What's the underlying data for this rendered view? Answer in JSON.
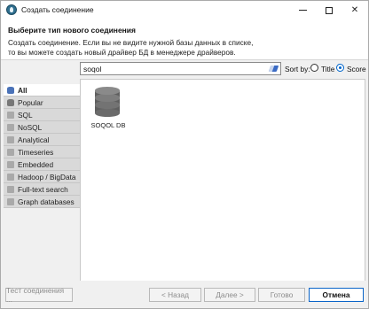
{
  "window": {
    "title": "Создать соединение",
    "minimize_glyph": "—",
    "maximize_glyph": "□",
    "close_glyph": "✕"
  },
  "header": {
    "title": "Выберите тип нового соединения",
    "description_line1": "Создать соединение. Если вы не видите нужной базы данных в списке,",
    "description_line2": "то вы можете создать новый драйвер БД в менеджере драйверов."
  },
  "search": {
    "value": "soqol",
    "clear_icon": "eraser-icon"
  },
  "sort": {
    "label": "Sort by:",
    "options": [
      {
        "label": "Title",
        "checked": false
      },
      {
        "label": "Score",
        "checked": true
      }
    ]
  },
  "categories": [
    {
      "label": "All",
      "active": true,
      "icon": "database-icon"
    },
    {
      "label": "Popular",
      "active": false,
      "icon": "database-icon"
    },
    {
      "label": "SQL",
      "active": false,
      "icon": "folder-icon"
    },
    {
      "label": "NoSQL",
      "active": false,
      "icon": "folder-icon"
    },
    {
      "label": "Analytical",
      "active": false,
      "icon": "folder-icon"
    },
    {
      "label": "Timeseries",
      "active": false,
      "icon": "folder-icon"
    },
    {
      "label": "Embedded",
      "active": false,
      "icon": "folder-icon"
    },
    {
      "label": "Hadoop / BigData",
      "active": false,
      "icon": "folder-icon"
    },
    {
      "label": "Full-text search",
      "active": false,
      "icon": "folder-icon"
    },
    {
      "label": "Graph databases",
      "active": false,
      "icon": "folder-icon"
    }
  ],
  "drivers": [
    {
      "label": "SOQOL DB",
      "icon": "database-icon"
    }
  ],
  "footer": {
    "test_label": "Тест соединения ...",
    "back_label": "< Назад",
    "next_label": "Далее >",
    "finish_label": "Готово",
    "cancel_label": "Отмена"
  },
  "colors": {
    "accent": "#0066cc",
    "category_bg": "#d9d9d9",
    "panel_bg": "#f0f0f0"
  }
}
